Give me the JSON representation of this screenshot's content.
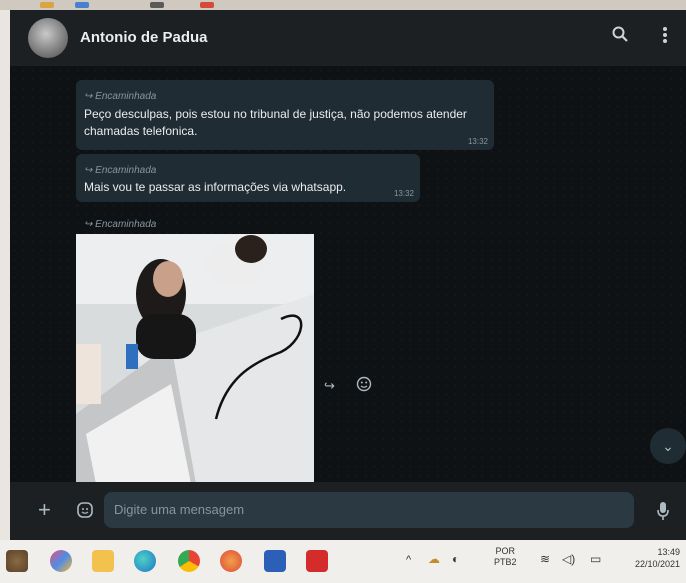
{
  "chat": {
    "contact_name": "Antonio de Padua",
    "messages": [
      {
        "forwarded_label": "Encaminhada",
        "text": "Peço desculpas, pois estou no tribunal de justiça, não podemos atender chamadas telefonica.",
        "time": "13:32"
      },
      {
        "forwarded_label": "Encaminhada",
        "text": "Mais vou te passar as informações via whatsapp.",
        "time": "13:32"
      },
      {
        "forwarded_label": "Encaminhada",
        "type": "image"
      }
    ]
  },
  "composer": {
    "placeholder": "Digite uma mensagem"
  },
  "tray": {
    "language": "POR",
    "layout": "PTB2",
    "time": "13:49",
    "date": "22/10/2021"
  },
  "icons": {
    "search": "search-icon",
    "menu": "more-vert-icon",
    "add": "plus-icon",
    "sticker": "sticker-icon",
    "mic": "mic-icon",
    "forward": "forward-icon",
    "react": "emoji-icon",
    "scroll": "chevron-down-icon"
  },
  "colors": {
    "accent": "#00a884",
    "bubble": "#202c33",
    "header": "#1c2023"
  }
}
